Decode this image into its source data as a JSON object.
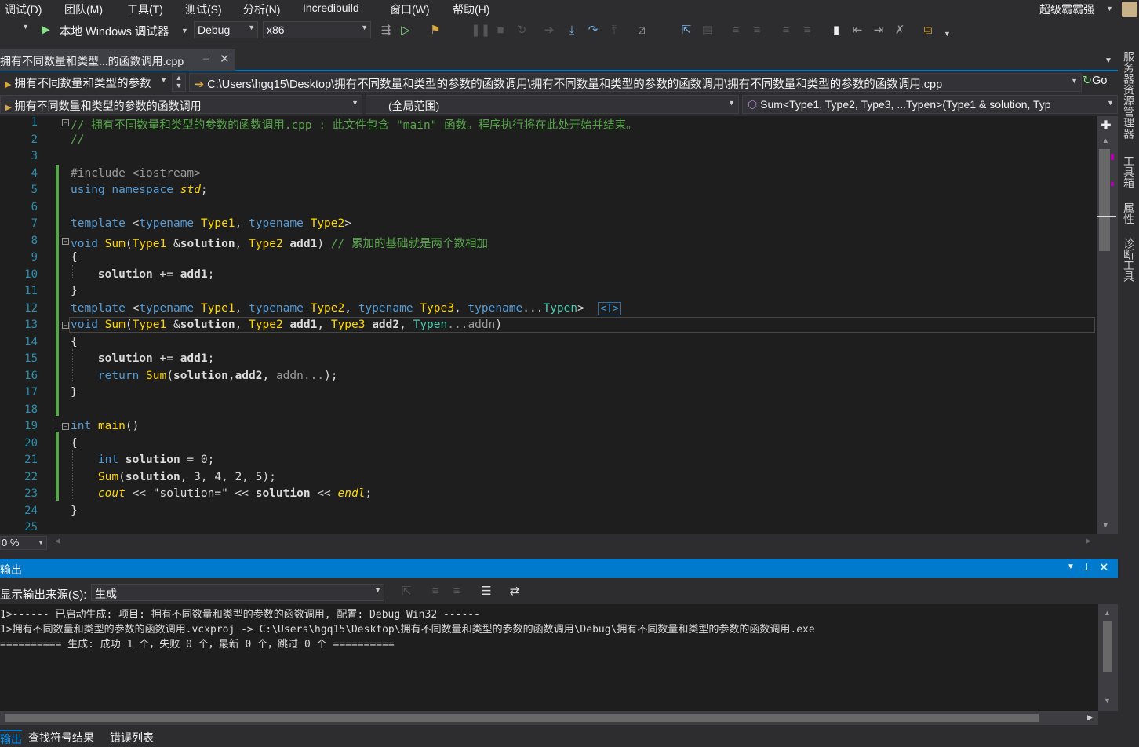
{
  "menu": [
    "调试(D)",
    "团队(M)",
    "工具(T)",
    "测试(S)",
    "分析(N)",
    "Incredibuild",
    "窗口(W)",
    "帮助(H)"
  ],
  "user_name": "超级霸霸强",
  "toolbar": {
    "debugger": "本地 Windows 调试器",
    "config": "Debug",
    "platform": "x86"
  },
  "tab": {
    "title": "拥有不同数量和类型...的函数调用.cpp"
  },
  "nav": {
    "project": "拥有不同数量和类型的参数",
    "path": "C:\\Users\\hgq15\\Desktop\\拥有不同数量和类型的参数的函数调用\\拥有不同数量和类型的参数的函数调用\\拥有不同数量和类型的参数的函数调用.cpp",
    "go": "Go",
    "file_scope": "拥有不同数量和类型的参数的函数调用",
    "global_scope": "(全局范围)",
    "member": "Sum<Type1, Type2, Type3, ...Typen>(Type1 & solution, Typ"
  },
  "code": {
    "line_numbers": [
      "1",
      "2",
      "3",
      "4",
      "5",
      "6",
      "7",
      "8",
      "9",
      "10",
      "11",
      "12",
      "13",
      "14",
      "15",
      "16",
      "17",
      "18",
      "19",
      "20",
      "21",
      "22",
      "23",
      "24",
      "25"
    ],
    "l1": "// 拥有不同数量和类型的参数的函数调用.cpp : 此文件包含 \"main\" 函数。程序执行将在此处开始并结束。",
    "l2": "//",
    "l4a": "#include ",
    "l4b": "<iostream>",
    "l5a": "using namespace ",
    "l5b": "std",
    "l5c": ";",
    "template": "template",
    "typename": "typename",
    "type1": "Type1",
    "type2": "Type2",
    "type3": "Type3",
    "typen": "Typen",
    "void": "void",
    "sum": "Sum",
    "solution": "solution",
    "add1": "add1",
    "add2": "add2",
    "addn": "addn",
    "l8cm": "// 累加的基础就是两个数相加",
    "tag": "<T>",
    "return": "return",
    "int": "int",
    "main": "main",
    "cout": "cout",
    "endl": "endl",
    "str": "\"solution=\"",
    "args": "3, 4, 2, 5"
  },
  "zoom": "0 %",
  "output": {
    "title": "输出",
    "source_label": "显示输出来源(S):",
    "source_value": "生成",
    "lines": [
      "1>------ 已启动生成: 项目: 拥有不同数量和类型的参数的函数调用, 配置: Debug Win32 ------",
      "1>拥有不同数量和类型的参数的函数调用.vcxproj -> C:\\Users\\hgq15\\Desktop\\拥有不同数量和类型的参数的函数调用\\Debug\\拥有不同数量和类型的参数的函数调用.exe",
      "========== 生成: 成功 1 个，失败 0 个，最新 0 个，跳过 0 个 =========="
    ]
  },
  "right_rail": [
    "服务器资源管理器",
    "工具箱",
    "属性",
    "诊断工具"
  ],
  "bottom_tabs": [
    "输出",
    "查找符号结果",
    "错误列表"
  ]
}
